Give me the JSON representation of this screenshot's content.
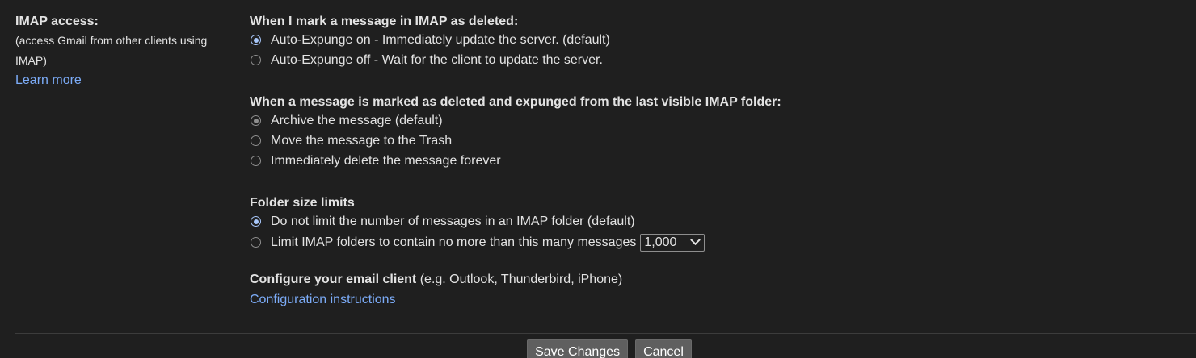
{
  "sidebar": {
    "title": "IMAP access:",
    "subtitle": "(access Gmail from other clients using IMAP)",
    "learn_more": "Learn more"
  },
  "expunge": {
    "title": "When I mark a message in IMAP as deleted:",
    "options": [
      {
        "label": "Auto-Expunge on - Immediately update the server. (default)",
        "checked": true
      },
      {
        "label": "Auto-Expunge off - Wait for the client to update the server.",
        "checked": false
      }
    ]
  },
  "deleted_action": {
    "title": "When a message is marked as deleted and expunged from the last visible IMAP folder:",
    "options": [
      {
        "label": "Archive the message (default)",
        "checked": true
      },
      {
        "label": "Move the message to the Trash",
        "checked": false
      },
      {
        "label": "Immediately delete the message forever",
        "checked": false
      }
    ]
  },
  "folder_limits": {
    "title": "Folder size limits",
    "options": [
      {
        "label": "Do not limit the number of messages in an IMAP folder (default)",
        "checked": true
      },
      {
        "label": "Limit IMAP folders to contain no more than this many messages",
        "checked": false
      }
    ],
    "limit_value": "1,000"
  },
  "configure": {
    "title": "Configure your email client",
    "hint": " (e.g. Outlook, Thunderbird, iPhone)",
    "link": "Configuration instructions"
  },
  "actions": {
    "save": "Save Changes",
    "cancel": "Cancel"
  },
  "colors": {
    "background": "#1f1f1f",
    "text": "#e3e3e3",
    "link": "#7cacf8",
    "radio_checked": "#a8c7fa",
    "button": "#5f5f5f"
  }
}
